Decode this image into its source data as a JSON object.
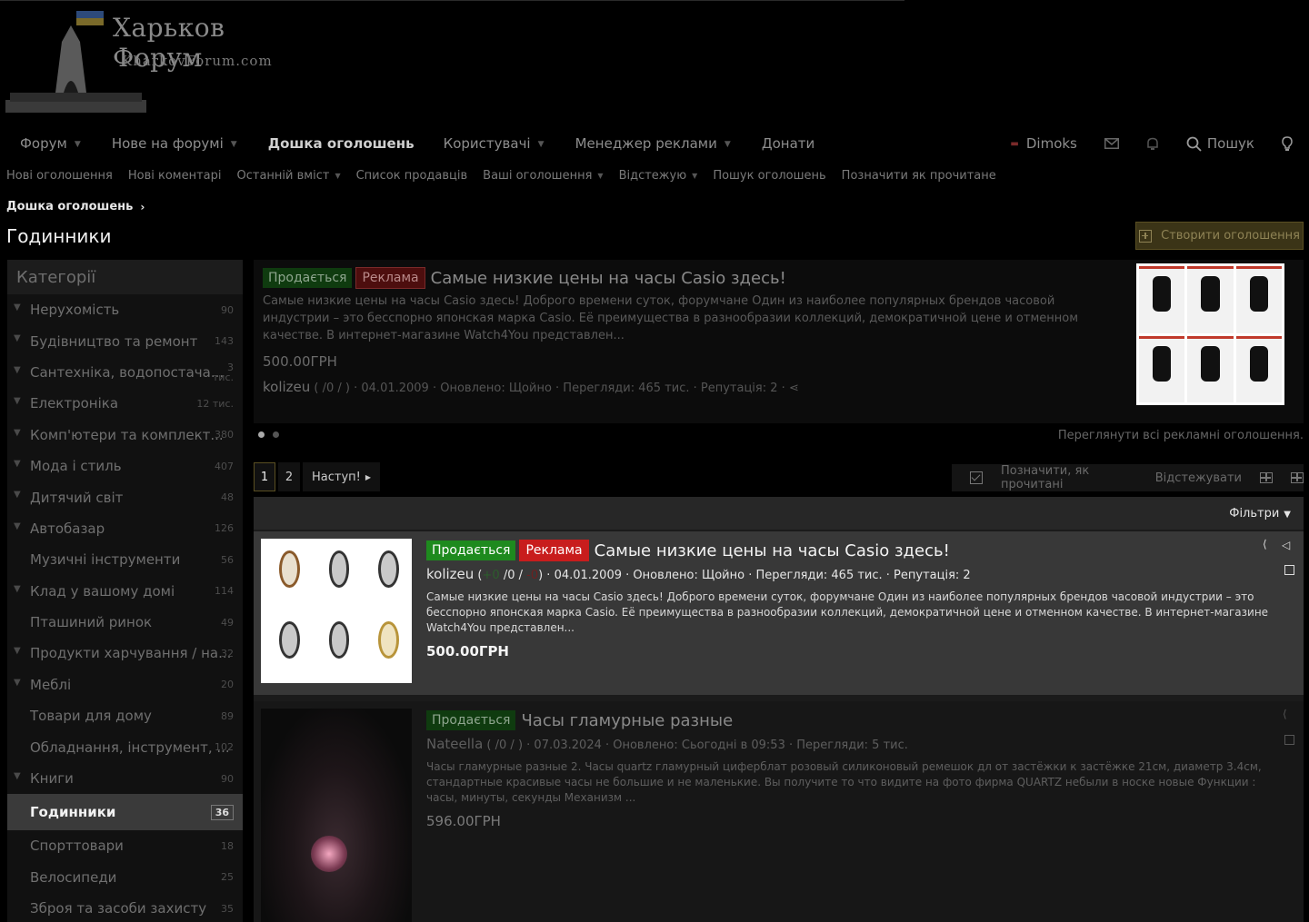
{
  "logo": {
    "title": "Харьков Форум",
    "subtitle": "KharkovForum.com"
  },
  "nav": {
    "items": [
      {
        "label": "Форум",
        "dropdown": true
      },
      {
        "label": "Нове на форумі",
        "dropdown": true
      },
      {
        "label": "Дошка оголошень",
        "dropdown": false
      },
      {
        "label": "Користувачі",
        "dropdown": true
      },
      {
        "label": "Менеджер реклами",
        "dropdown": true
      },
      {
        "label": "Донати",
        "dropdown": false
      }
    ],
    "user": "Dimoks",
    "search": "Пошук"
  },
  "subnav": [
    "Нові оголошення",
    "Нові коментарі",
    "Останній вміст",
    "Список продавців",
    "Ваші оголошення",
    "Відстежую",
    "Пошук оголошень",
    "Позначити як прочитане"
  ],
  "breadcrumb": "Дошка оголошень",
  "page_title": "Годинники",
  "create_button": "Створити оголошення",
  "sidebar": {
    "title": "Категорії",
    "items": [
      {
        "label": "Нерухомість",
        "count": "90",
        "arrow": true
      },
      {
        "label": "Будівництво та ремонт",
        "count": "143",
        "arrow": true
      },
      {
        "label": "Сантехніка, водопостача...",
        "count": "3\nтис.",
        "arrow": true
      },
      {
        "label": "Електроніка",
        "count": "12 тис.",
        "arrow": true
      },
      {
        "label": "Комп'ютери та комплект...",
        "count": "380",
        "arrow": true
      },
      {
        "label": "Мода і стиль",
        "count": "407",
        "arrow": true
      },
      {
        "label": "Дитячий світ",
        "count": "48",
        "arrow": true
      },
      {
        "label": "Автобазар",
        "count": "126",
        "arrow": true
      },
      {
        "label": "Музичні інструменти",
        "count": "56",
        "arrow": false
      },
      {
        "label": "Клад у вашому домі",
        "count": "114",
        "arrow": true
      },
      {
        "label": "Пташиний ринок",
        "count": "49",
        "arrow": false
      },
      {
        "label": "Продукти харчування / на...",
        "count": "32",
        "arrow": true
      },
      {
        "label": "Меблі",
        "count": "20",
        "arrow": true
      },
      {
        "label": "Товари для дому",
        "count": "89",
        "arrow": false
      },
      {
        "label": "Обладнання, інструмент, ...",
        "count": "102",
        "arrow": false
      },
      {
        "label": "Книги",
        "count": "90",
        "arrow": true
      },
      {
        "label": "Годинники",
        "count": "36",
        "arrow": false,
        "active": true
      },
      {
        "label": "Спорттовари",
        "count": "18",
        "arrow": false
      },
      {
        "label": "Велосипеди",
        "count": "25",
        "arrow": false
      },
      {
        "label": "Зброя та засоби захисту",
        "count": "35",
        "arrow": false
      }
    ]
  },
  "featured": {
    "badge_sale": "Продається",
    "badge_ad": "Реклама",
    "title": "Самые низкие цены на часы Casio здесь!",
    "description": "Самые низкие цены на часы Casio здесь! Доброго времени суток, форумчане Один из наиболее популярных брендов часовой индустрии – это бесспорно японская марка Casio. Её преимущества в разнообразии коллекций, демократичной цене и отменном качестве. В интернет-магазине Watch4You представлен...",
    "price": "500.00ГРН",
    "author": "kolizeu",
    "meta": "( /0 / ) · 04.01.2009 · Оновлено: Щойно · Перегляди: 465 тис. · Репутація: 2 ·",
    "view_all": "Переглянути всі рекламні оголошення."
  },
  "pager": {
    "pages": [
      "1",
      "2"
    ],
    "next": "Наступ!"
  },
  "toolbar": {
    "mark_read": "Позначити, як прочитані",
    "watch": "Відстежувати"
  },
  "filters": "Фільтри",
  "listings": [
    {
      "badge_sale": "Продається",
      "badge_ad": "Реклама",
      "title": "Самые низкие цены на часы Casio здесь!",
      "author": "kolizeu",
      "meta_pre": "(",
      "rep_plus": "+0",
      "meta_mid": "/0 /",
      "rep_minus": "-0",
      "meta_post": ") · 04.01.2009 · Оновлено: Щойно · Перегляди: 465 тис. · Репутація: 2",
      "description": "Самые низкие цены на часы Casio здесь! Доброго времени суток, форумчане Один из наиболее популярных брендов часовой индустрии – это бесспорно японская марка Casio. Её преимущества в разнообразии коллекций, демократичной цене и отменном качестве. В интернет-магазине Watch4You представлен...",
      "price": "500.00ГРН"
    },
    {
      "badge_sale": "Продається",
      "title": "Часы гламурные разные",
      "author": "Nateella",
      "meta_pre": "(",
      "meta_mid": "/0 /",
      "meta_post": ") · 07.03.2024 · Оновлено: Сьогодні в 09:53 · Перегляди: 5 тис.",
      "description": "Часы гламурные разные 2. Часы quartz гламурный циферблат розовый силиконовый ремешок дл от застёжки к застёжке 21см, диаметр 3.4см, стандартные красивые часы не большие и не маленькие. Вы получите то что видите на фото фирма QUARTZ небыли в носке новые Функции : часы, минуты, секунды Механизм ...",
      "price": "596.00ГРН"
    }
  ]
}
